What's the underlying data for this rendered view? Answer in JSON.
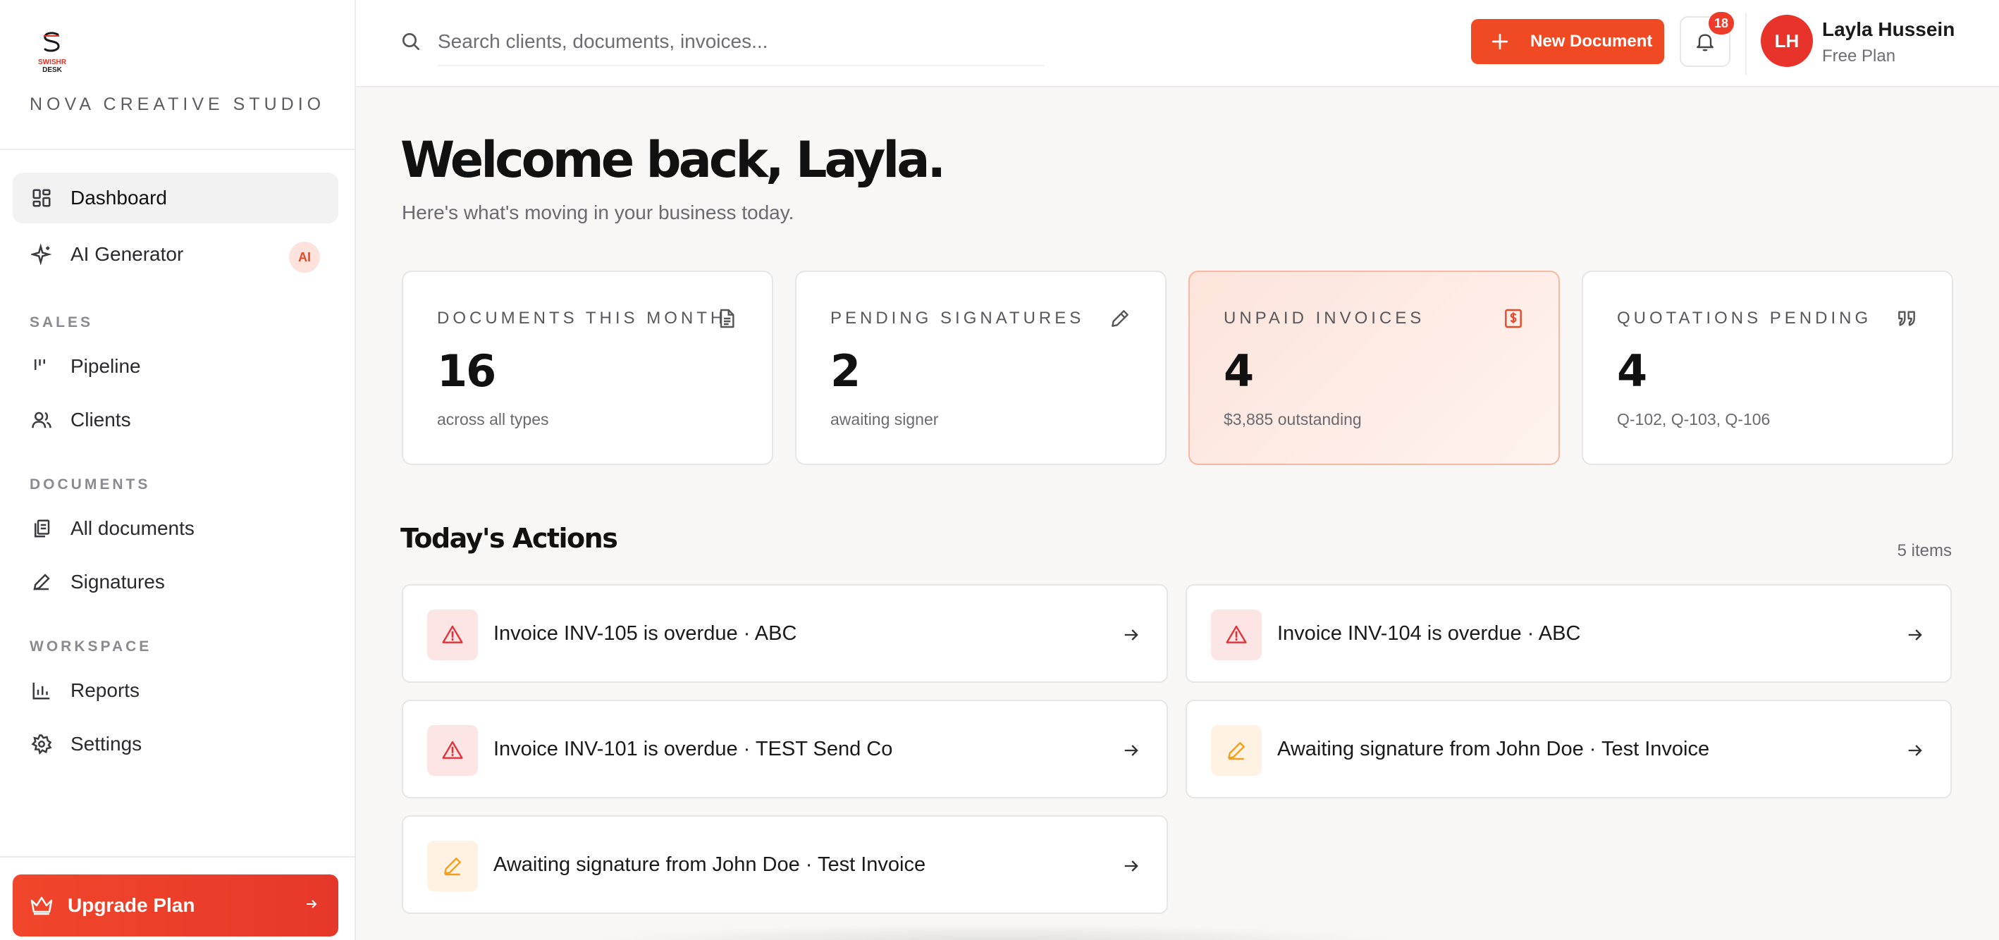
{
  "brand": {
    "logo_line1": "SWISHR",
    "logo_line2": "DESK",
    "studio_name": "NOVA CREATIVE STUDIO"
  },
  "sidebar": {
    "dashboard": "Dashboard",
    "ai_generator": "AI Generator",
    "ai_badge": "AI",
    "section_sales": "SALES",
    "pipeline": "Pipeline",
    "clients": "Clients",
    "section_documents": "DOCUMENTS",
    "all_documents": "All documents",
    "signatures": "Signatures",
    "section_workspace": "WORKSPACE",
    "reports": "Reports",
    "settings": "Settings",
    "upgrade": "Upgrade Plan"
  },
  "topbar": {
    "search_placeholder": "Search clients, documents, invoices...",
    "new_document": "New Document",
    "notification_count": "18",
    "avatar_initials": "LH",
    "user_name": "Layla Hussein",
    "user_plan": "Free Plan"
  },
  "main": {
    "welcome": "Welcome back, Layla.",
    "subtitle": "Here's what's moving in your business today."
  },
  "stats": [
    {
      "label": "DOCUMENTS THIS MONTH",
      "value": "16",
      "note": "across all types",
      "icon": "document-icon"
    },
    {
      "label": "PENDING SIGNATURES",
      "value": "2",
      "note": "awaiting signer",
      "icon": "pen-icon"
    },
    {
      "label": "UNPAID INVOICES",
      "value": "4",
      "note": "$3,885 outstanding",
      "icon": "dollar-receipt-icon"
    },
    {
      "label": "QUOTATIONS PENDING",
      "value": "4",
      "note": "Q-102, Q-103, Q-106",
      "icon": "quote-icon"
    }
  ],
  "actions": {
    "title": "Today's Actions",
    "count": "5 items",
    "items": [
      {
        "text": "Invoice INV-105 is overdue · ABC",
        "type": "alert"
      },
      {
        "text": "Invoice INV-104 is overdue · ABC",
        "type": "alert"
      },
      {
        "text": "Invoice INV-101 is overdue · TEST Send Co",
        "type": "alert"
      },
      {
        "text": "Awaiting signature from John Doe · Test Invoice",
        "type": "sign"
      },
      {
        "text": "Awaiting signature from John Doe · Test Invoice",
        "type": "sign"
      }
    ]
  },
  "colors": {
    "accent": "#f04a25",
    "alert": "#e0343a",
    "sign": "#f0a020"
  }
}
